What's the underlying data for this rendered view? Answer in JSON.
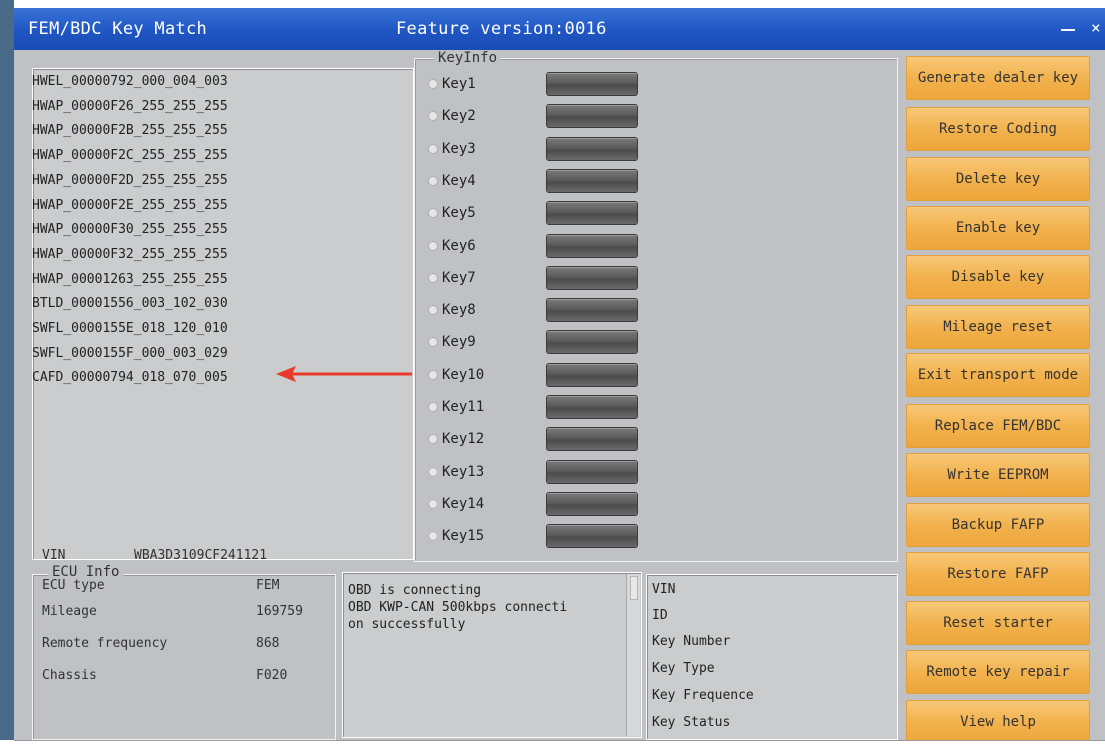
{
  "window": {
    "title": "FEM/BDC Key Match",
    "feature_version": "Feature version:0016",
    "minimize_label": "–",
    "close_label": "×"
  },
  "file_list": [
    "HWEL_00000792_000_004_003",
    "HWAP_00000F26_255_255_255",
    "HWAP_00000F2B_255_255_255",
    "HWAP_00000F2C_255_255_255",
    "HWAP_00000F2D_255_255_255",
    "HWAP_00000F2E_255_255_255",
    "HWAP_00000F30_255_255_255",
    "HWAP_00000F32_255_255_255",
    "HWAP_00001263_255_255_255",
    "BTLD_00001556_003_102_030",
    "SWFL_0000155E_018_120_010",
    "SWFL_0000155F_000_003_029",
    "CAFD_00000794_018_070_005"
  ],
  "key_info": {
    "legend": "KeyInfo",
    "keys": [
      "Key1",
      "Key2",
      "Key3",
      "Key4",
      "Key5",
      "Key6",
      "Key7",
      "Key8",
      "Key9",
      "Key10",
      "Key11",
      "Key12",
      "Key13",
      "Key14",
      "Key15"
    ]
  },
  "buttons": [
    "Generate dealer key",
    "Restore Coding",
    "Delete key",
    "Enable key",
    "Disable key",
    "Mileage reset",
    "Exit transport mode",
    "Replace FEM/BDC",
    "Write EEPROM",
    "Backup FAFP",
    "Restore FAFP",
    "Reset starter",
    "Remote key repair",
    "View help"
  ],
  "ecu_info": {
    "legend": "ECU Info",
    "rows": [
      {
        "label": "VIN",
        "value": "WBA3D3109CF241121"
      },
      {
        "label": "ECU type",
        "value": "FEM"
      },
      {
        "label": "Mileage",
        "value": "169759"
      },
      {
        "label": "Remote frequency",
        "value": "868"
      },
      {
        "label": "Chassis",
        "value": "F020"
      }
    ]
  },
  "log": {
    "lines": [
      "OBD is connecting",
      "OBD KWP-CAN 500kbps connecti",
      "on successfully"
    ]
  },
  "key_details": {
    "lines": [
      "VIN",
      "ID",
      "Key Number",
      "Key Type",
      "Key Frequence",
      "Key Status"
    ]
  },
  "colors": {
    "title_bar": "#1f56c4",
    "button_orange": "#f2b24e",
    "arrow_red": "#e8392b"
  }
}
